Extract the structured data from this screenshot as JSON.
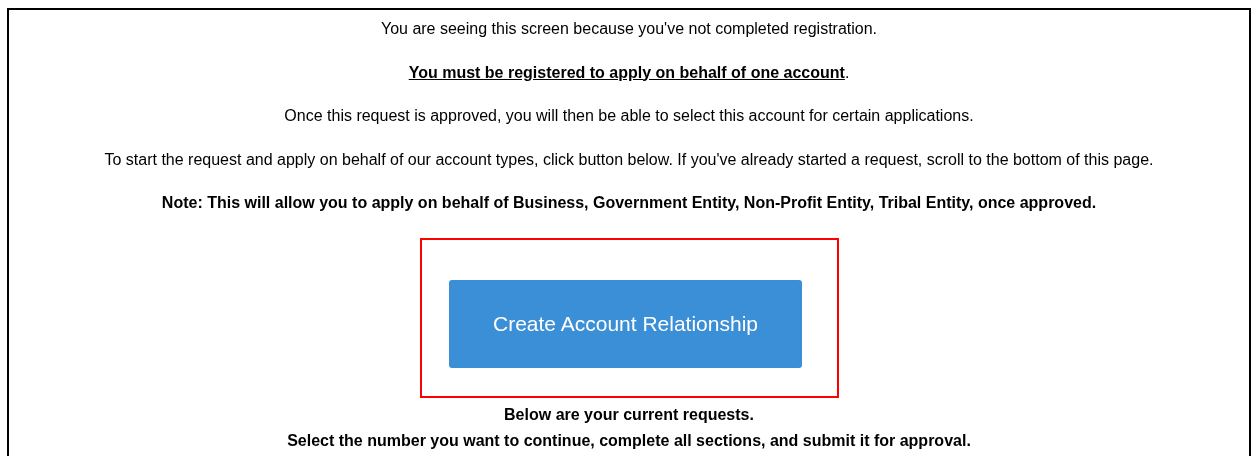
{
  "paragraphs": [
    {
      "kind": "plain",
      "text": "You are seeing this screen because you've not completed registration."
    },
    {
      "kind": "emphasis",
      "text": "**You must be registered to apply on behalf of one account**."
    },
    {
      "kind": "plain",
      "text": "Once this request is approved, you will then be able to select this account for certain applications."
    },
    {
      "kind": "plain",
      "text": "To start the request and apply on behalf of our account types, click button below. If you've already started a request, scroll to the bottom of this page."
    },
    {
      "kind": "bold",
      "text": "Note: This will allow you to apply on behalf of Business, Government Entity, Non-Profit Entity, Tribal Entity, once approved."
    }
  ],
  "highlighted": true,
  "button": {
    "label": "Create Account Relationship"
  },
  "footer_lines": [
    {
      "kind": "bold",
      "text": "Below are your current requests."
    },
    {
      "kind": "bold",
      "text": "Select the number you want to continue, complete all sections, and submit it for approval."
    }
  ]
}
